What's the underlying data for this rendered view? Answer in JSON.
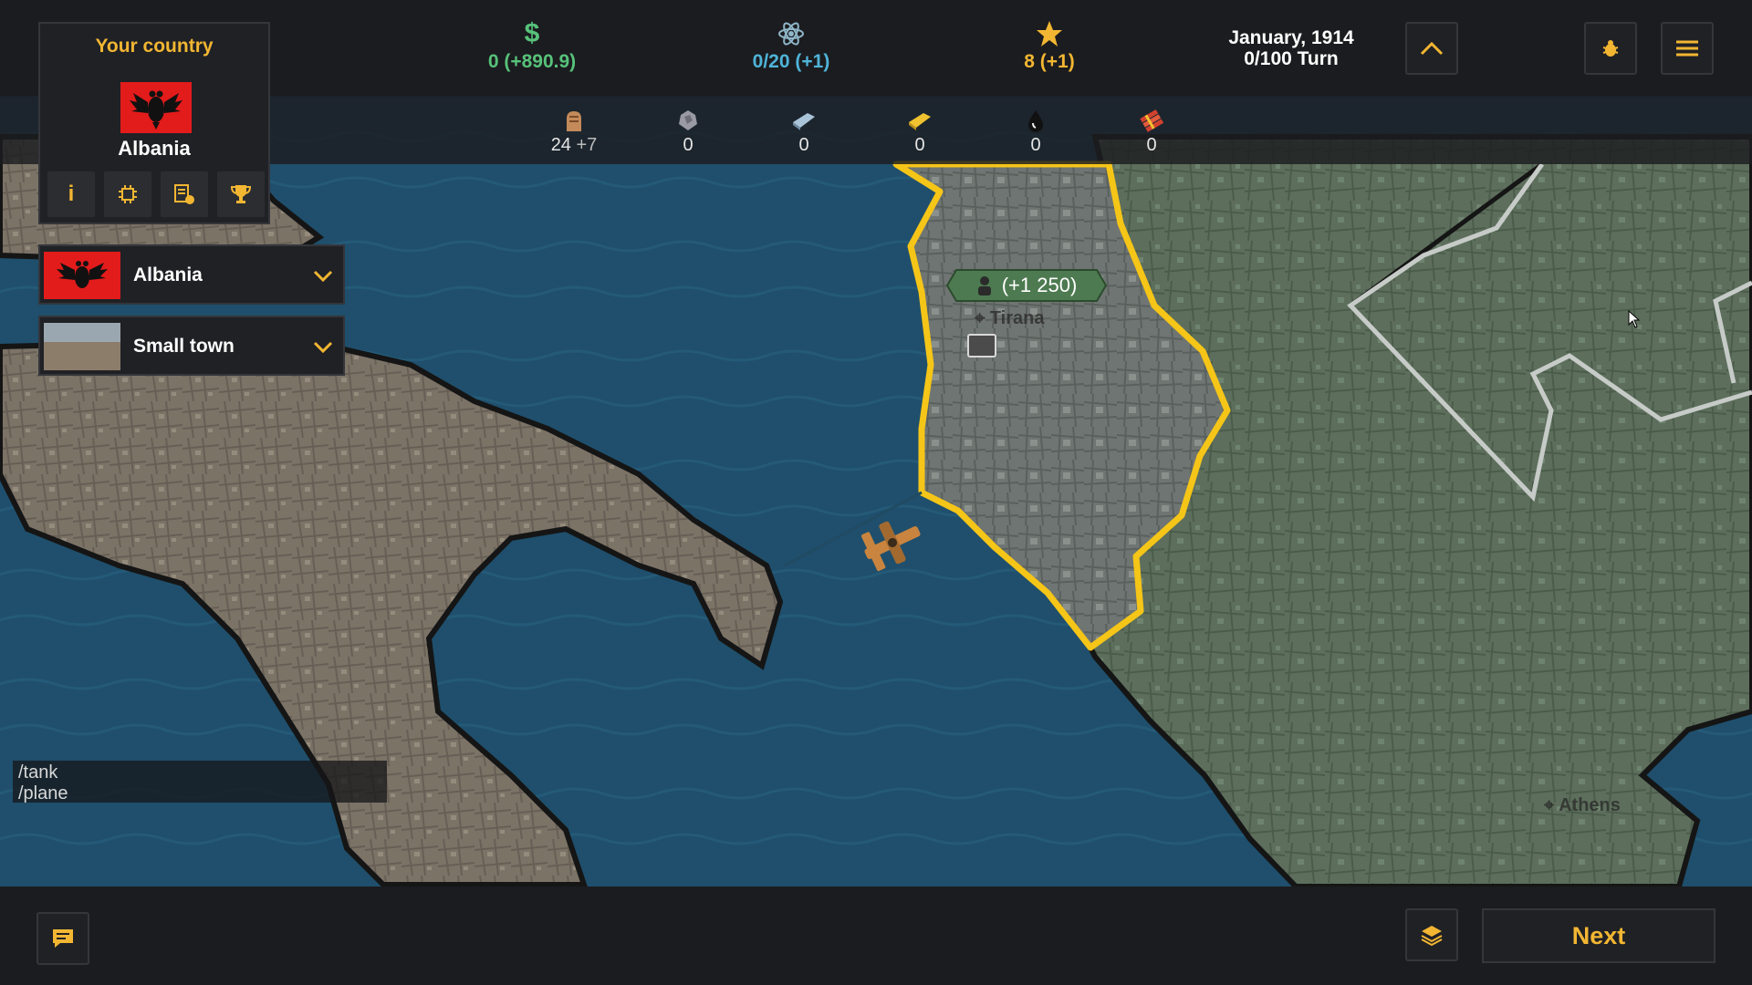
{
  "economy": {
    "money": "0 (+890.9)",
    "science": "0/20 (+1)",
    "prestige": "8 (+1)"
  },
  "date": {
    "month_year": "January, 1914",
    "turn": "0/100 Turn"
  },
  "resources": [
    {
      "icon": "manpower-icon",
      "value": "24",
      "delta": "+7"
    },
    {
      "icon": "iron-icon",
      "value": "0",
      "delta": ""
    },
    {
      "icon": "steel-icon",
      "value": "0",
      "delta": ""
    },
    {
      "icon": "gold-icon",
      "value": "0",
      "delta": ""
    },
    {
      "icon": "oil-icon",
      "value": "0",
      "delta": ""
    },
    {
      "icon": "explosives-icon",
      "value": "0",
      "delta": ""
    }
  ],
  "country_panel": {
    "title": "Your country",
    "country_name": "Albania",
    "buttons": [
      "info-icon",
      "technology-icon",
      "policy-icon",
      "trophy-icon"
    ]
  },
  "selectors": {
    "country": "Albania",
    "region": "Small town"
  },
  "map": {
    "population_badge": "(+1 250)",
    "city_capital": "Tirana",
    "city_other": "Athens"
  },
  "console": {
    "lines": [
      "/tank",
      "/plane"
    ]
  },
  "bottom": {
    "next_label": "Next"
  },
  "colors": {
    "accent": "#f2b632",
    "money": "#57c27a",
    "science": "#4fb4d9",
    "player_border": "#f5c518",
    "sea": "#1d4f6e"
  }
}
